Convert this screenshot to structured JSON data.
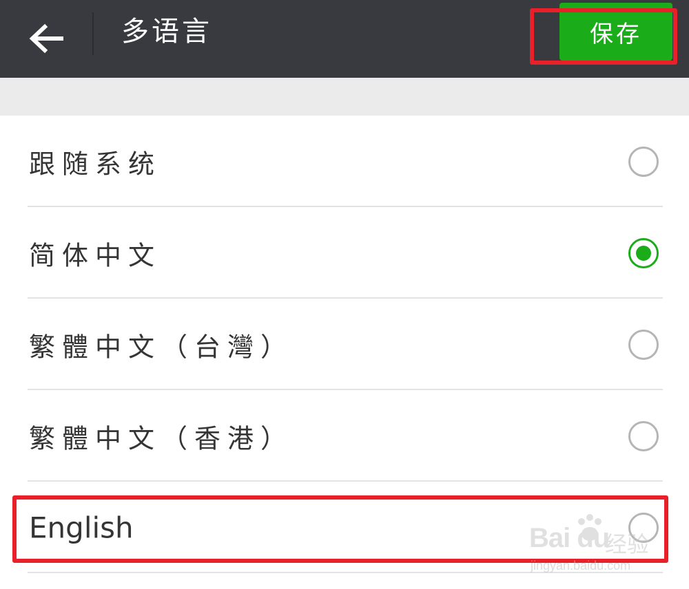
{
  "header": {
    "title": "多语言",
    "save_label": "保存",
    "back_icon": "arrow-left-icon"
  },
  "colors": {
    "topbar": "#393a3f",
    "accent": "#1aad19",
    "annotation": "#e8202a"
  },
  "languages": [
    {
      "label": "跟随系统",
      "selected": false
    },
    {
      "label": "简体中文",
      "selected": true
    },
    {
      "label": "繁體中文（台灣）",
      "selected": false
    },
    {
      "label": "繁體中文（香港）",
      "selected": false
    },
    {
      "label": "English",
      "selected": false
    }
  ],
  "watermark": {
    "brand": "Bai du",
    "sub": "经验",
    "url": "jingyan.baidu.com"
  }
}
